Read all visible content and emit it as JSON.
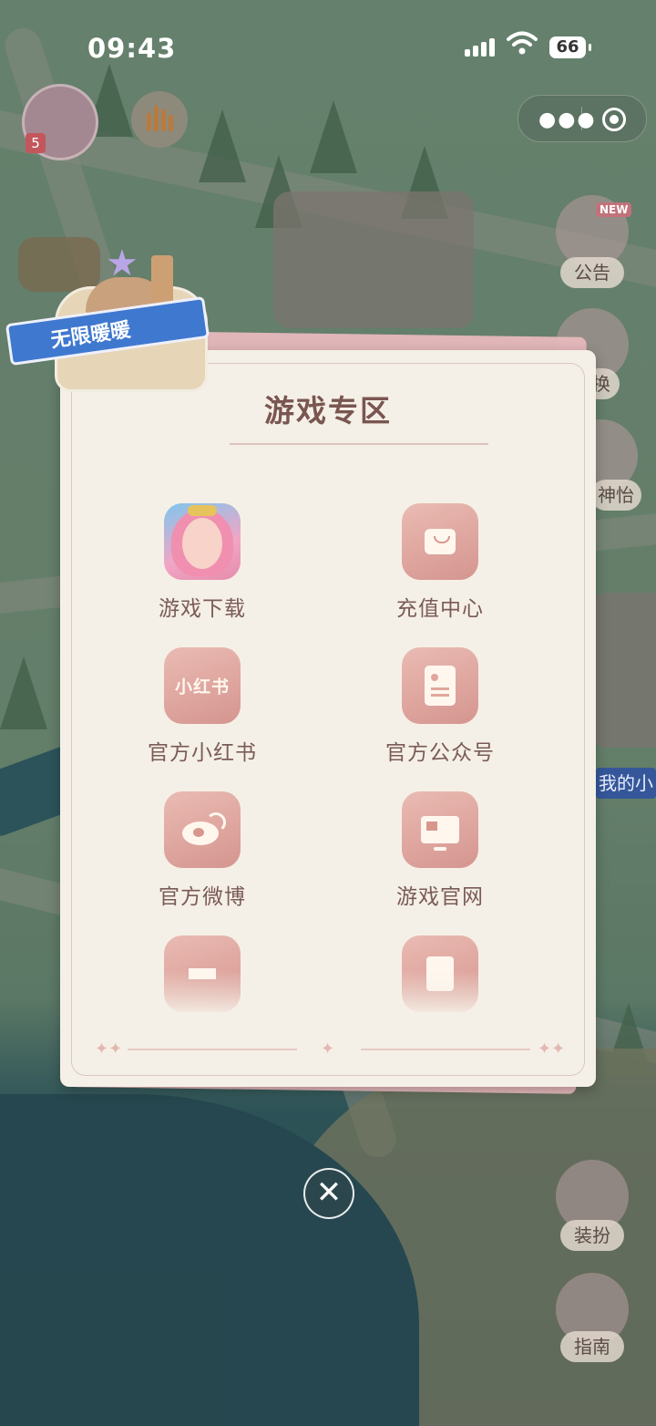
{
  "status_bar": {
    "time": "09:43",
    "battery": "66"
  },
  "capsule": {
    "more_icon": "more-dots-icon",
    "close_icon": "target-circle-icon"
  },
  "map": {
    "level_badge": "5",
    "side_buttons": [
      {
        "label": "公告",
        "icon": "notice-board-icon",
        "tag": "NEW"
      },
      {
        "label": "换",
        "icon": "exchange-icon"
      },
      {
        "label": "神怡",
        "icon": "relax-icon"
      },
      {
        "label": "装扮",
        "icon": "dress-up-icon"
      },
      {
        "label": "指南",
        "icon": "guide-icon"
      }
    ],
    "house_sign": "我的小"
  },
  "modal": {
    "title": "游戏专区",
    "badge_text": "无限暖暖",
    "items": [
      {
        "label": "游戏下载",
        "icon": "game-app-icon"
      },
      {
        "label": "充值中心",
        "icon": "shopping-bag-icon"
      },
      {
        "label": "官方小红书",
        "icon": "xiaohongshu-icon",
        "glyph_text": "小红书"
      },
      {
        "label": "官方公众号",
        "icon": "document-icon"
      },
      {
        "label": "官方微博",
        "icon": "weibo-icon"
      },
      {
        "label": "游戏官网",
        "icon": "monitor-icon"
      },
      {
        "label": "",
        "icon": "graduate-mascot-icon"
      },
      {
        "label": "",
        "icon": "pen-paper-icon"
      }
    ]
  },
  "close_button": {
    "icon": "close-icon",
    "glyph": "✕"
  }
}
